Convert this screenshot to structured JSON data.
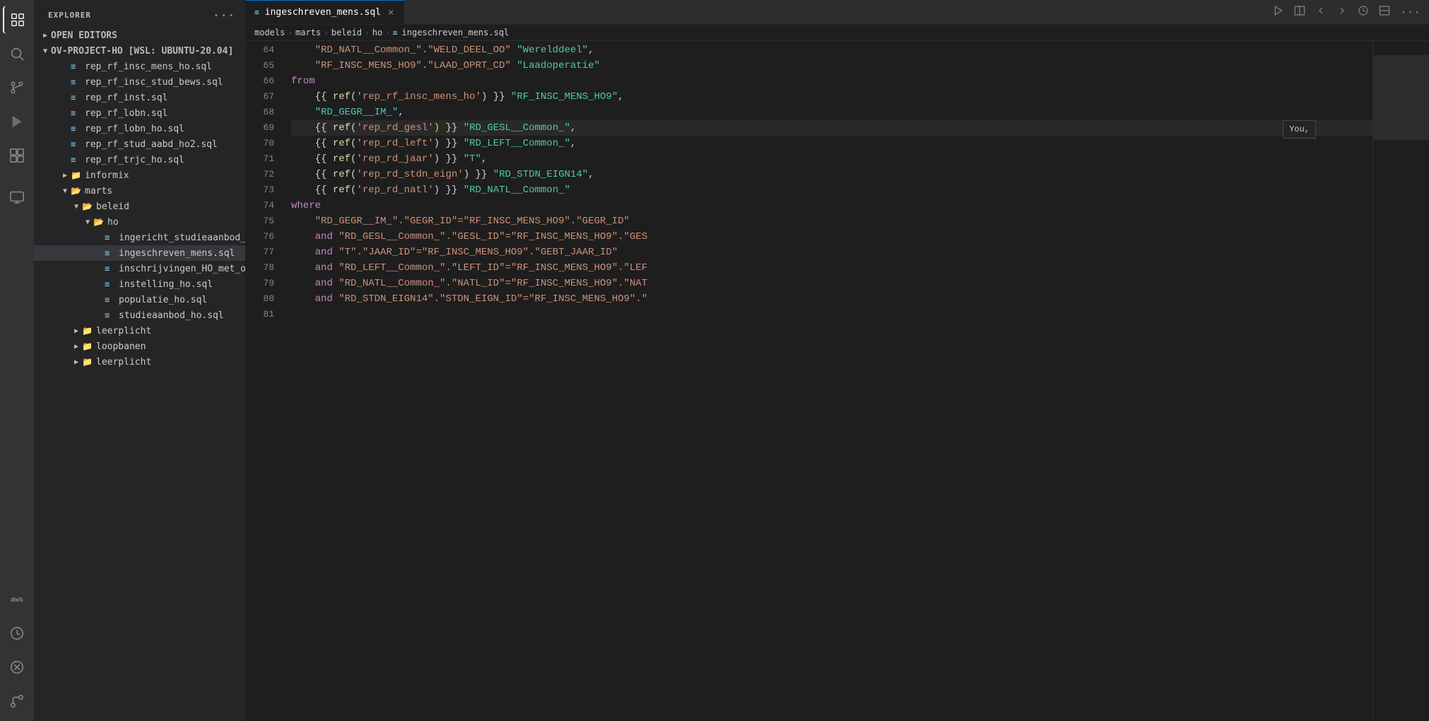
{
  "activityBar": {
    "icons": [
      {
        "name": "explorer-icon",
        "symbol": "⬜",
        "active": true,
        "label": "Explorer"
      },
      {
        "name": "search-icon",
        "symbol": "🔍",
        "active": false,
        "label": "Search"
      },
      {
        "name": "source-control-icon",
        "symbol": "⑂",
        "active": false,
        "label": "Source Control"
      },
      {
        "name": "run-debug-icon",
        "symbol": "▷",
        "active": false,
        "label": "Run and Debug"
      },
      {
        "name": "extensions-icon",
        "symbol": "⊞",
        "active": false,
        "label": "Extensions"
      },
      {
        "name": "remote-icon",
        "symbol": "⊡",
        "active": false,
        "label": "Remote Explorer"
      },
      {
        "name": "aws-icon",
        "symbol": "aws",
        "active": false,
        "label": "AWS"
      },
      {
        "name": "history-icon",
        "symbol": "◷",
        "active": false,
        "label": "History"
      },
      {
        "name": "cross-icon",
        "symbol": "✕",
        "active": false,
        "label": "Cross"
      },
      {
        "name": "git-icon",
        "symbol": "⏚",
        "active": false,
        "label": "Git"
      }
    ]
  },
  "sidebar": {
    "title": "EXPLORER",
    "moreOptionsLabel": "···",
    "sections": {
      "openEditors": {
        "label": "OPEN EDITORS",
        "collapsed": true
      },
      "project": {
        "label": "OV-PROJECT-HO [WSL: UBUNTU-20.04]",
        "collapsed": false
      }
    },
    "tree": [
      {
        "id": "open-editors",
        "label": "OPEN EDITORS",
        "type": "section",
        "indent": 0,
        "collapsed": true
      },
      {
        "id": "project-root",
        "label": "OV-PROJECT-HO [WSL: UBUNTU-20.04]",
        "type": "folder-open",
        "indent": 0,
        "collapsed": false
      },
      {
        "id": "rep_rf_insc_mens_ho",
        "label": "rep_rf_insc_mens_ho.sql",
        "type": "file",
        "indent": 2
      },
      {
        "id": "rep_rf_insc_stud_bews",
        "label": "rep_rf_insc_stud_bews.sql",
        "type": "file",
        "indent": 2
      },
      {
        "id": "rep_rf_inst",
        "label": "rep_rf_inst.sql",
        "type": "file",
        "indent": 2
      },
      {
        "id": "rep_rf_lobn",
        "label": "rep_rf_lobn.sql",
        "type": "file",
        "indent": 2
      },
      {
        "id": "rep_rf_lobn_ho",
        "label": "rep_rf_lobn_ho.sql",
        "type": "file",
        "indent": 2
      },
      {
        "id": "rep_rf_stud_aabd_ho2",
        "label": "rep_rf_stud_aabd_ho2.sql",
        "type": "file",
        "indent": 2
      },
      {
        "id": "rep_rf_trjc_ho",
        "label": "rep_rf_trjc_ho.sql",
        "type": "file",
        "indent": 2
      },
      {
        "id": "informix",
        "label": "informix",
        "type": "folder-closed",
        "indent": 2
      },
      {
        "id": "marts",
        "label": "marts",
        "type": "folder-open",
        "indent": 2
      },
      {
        "id": "beleid",
        "label": "beleid",
        "type": "folder-open",
        "indent": 3
      },
      {
        "id": "ho",
        "label": "ho",
        "type": "folder-open",
        "indent": 4
      },
      {
        "id": "ingericht_studieaanbod_ho",
        "label": "ingericht_studieaanbod_ho.sql",
        "type": "file",
        "indent": 5
      },
      {
        "id": "ingeschreven_mens",
        "label": "ingeschreven_mens.sql",
        "type": "file",
        "indent": 5,
        "selected": true
      },
      {
        "id": "inschrijvingen_HO_met_overervingen",
        "label": "inschrijvingen_HO_met_overervingen.sql",
        "type": "file",
        "indent": 5
      },
      {
        "id": "instelling_ho",
        "label": "instelling_ho.sql",
        "type": "file",
        "indent": 5
      },
      {
        "id": "populatie_ho",
        "label": "populatie_ho.sql",
        "type": "file",
        "indent": 5
      },
      {
        "id": "studieaanbod_ho",
        "label": "studieaanbod_ho.sql",
        "type": "file",
        "indent": 5
      },
      {
        "id": "leerplicht",
        "label": "leerplicht",
        "type": "folder-closed",
        "indent": 3
      },
      {
        "id": "loopbanen",
        "label": "loopbanen",
        "type": "folder-closed",
        "indent": 3
      },
      {
        "id": "leerplicht2",
        "label": "leerplicht",
        "type": "folder-closed",
        "indent": 3
      }
    ]
  },
  "editor": {
    "tab": {
      "icon": "≡",
      "filename": "ingeschreven_mens.sql",
      "closeLabel": "×"
    },
    "breadcrumb": {
      "parts": [
        "models",
        "marts",
        "beleid",
        "ho",
        "ingeschreven_mens.sql"
      ]
    },
    "lines": [
      {
        "num": 64,
        "content": [
          {
            "t": "    \"RD_NATL__Common_\".\"WELD_DEEL_OO\" \"Werelddeel\",",
            "c": "str"
          }
        ]
      },
      {
        "num": 65,
        "content": [
          {
            "t": "    \"RF_INSC_MENS_HO9\".\"LAAD_OPRT_CD\" \"Laadoperatie\"",
            "c": "str"
          }
        ]
      },
      {
        "num": 66,
        "content": [
          {
            "t": "from",
            "c": "kw-from"
          }
        ],
        "keyword_line": true
      },
      {
        "num": 67,
        "content": [
          {
            "t": "    {{ ref('rep_rf_insc_mens_ho') }} \"RF_INSC_MENS_HO9\",",
            "c": "mixed"
          }
        ]
      },
      {
        "num": 68,
        "content": [
          {
            "t": "    \"RD_GEGR__IM_\",",
            "c": "str"
          }
        ]
      },
      {
        "num": 69,
        "content": [
          {
            "t": "    {{ ref('rep_rd_gesl') }} \"RD_GESL__Common_\",",
            "c": "mixed",
            "tooltip": "You,"
          }
        ]
      },
      {
        "num": 70,
        "content": [
          {
            "t": "    {{ ref('rep_rd_left') }} \"RD_LEFT__Common_\",",
            "c": "mixed"
          }
        ]
      },
      {
        "num": 71,
        "content": [
          {
            "t": "    {{ ref('rep_rd_jaar') }} \"T\",",
            "c": "mixed"
          }
        ]
      },
      {
        "num": 72,
        "content": [
          {
            "t": "    {{ ref('rep_rd_stdn_eign') }} \"RD_STDN_EIGN14\",",
            "c": "mixed"
          }
        ]
      },
      {
        "num": 73,
        "content": [
          {
            "t": "    {{ ref('rep_rd_natl') }} \"RD_NATL__Common_\"",
            "c": "mixed"
          }
        ]
      },
      {
        "num": 74,
        "content": [
          {
            "t": "where",
            "c": "kw-where"
          }
        ],
        "keyword_line": true
      },
      {
        "num": 75,
        "content": [
          {
            "t": "    \"RD_GEGR__IM_\".\"GEGR_ID\"=\"RF_INSC_MENS_HO9\".\"GEGR_ID\"",
            "c": "str"
          }
        ]
      },
      {
        "num": 76,
        "content": [
          {
            "t": "    and \"RD_GESL__Common_\".\"GESL_ID\"=\"RF_INSC_MENS_HO9\".\"GES",
            "c": "mixed-and"
          }
        ]
      },
      {
        "num": 77,
        "content": [
          {
            "t": "    and \"T\".\"JAAR_ID\"=\"RF_INSC_MENS_HO9\".\"GEBT_JAAR_ID\"",
            "c": "mixed-and"
          }
        ]
      },
      {
        "num": 78,
        "content": [
          {
            "t": "    and \"RD_LEFT__Common_\".\"LEFT_ID\"=\"RF_INSC_MENS_HO9\".\"LEF",
            "c": "mixed-and"
          }
        ]
      },
      {
        "num": 79,
        "content": [
          {
            "t": "    and \"RD_NATL__Common_\".\"NATL_ID\"=\"RF_INSC_MENS_HO9\".\"NAT",
            "c": "mixed-and"
          }
        ]
      },
      {
        "num": 80,
        "content": [
          {
            "t": "    and \"RD_STDN_EIGN14\".\"STDN_EIGN_ID\"=\"RF_INSC_MENS_HO9\".\"",
            "c": "mixed-and"
          }
        ]
      },
      {
        "num": 81,
        "content": [
          {
            "t": "",
            "c": "plain"
          }
        ]
      }
    ]
  },
  "colors": {
    "accent": "#0078d4",
    "background": "#1e1e1e",
    "sidebar": "#252526",
    "tabBar": "#2d2d2d",
    "selected": "#37373d",
    "keyword": "#c586c0",
    "string": "#ce9178",
    "ref": "#9cdcfe",
    "func": "#dcdcaa",
    "alias": "#4ec9b0",
    "lineNumber": "#858585"
  }
}
